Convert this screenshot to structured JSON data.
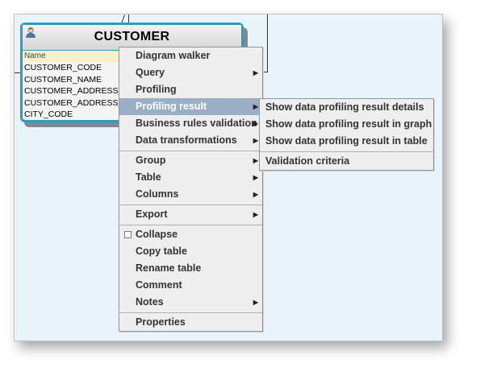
{
  "entity": {
    "title": "CUSTOMER",
    "column_header": "Name",
    "columns": [
      "CUSTOMER_CODE",
      "CUSTOMER_NAME",
      "CUSTOMER_ADDRESS_L",
      "CUSTOMER_ADDRESS_L",
      "CITY_CODE"
    ]
  },
  "context_menu": {
    "groups": [
      [
        "Diagram walker",
        "Query",
        "Profiling",
        "Profiling result",
        "Business rules validation",
        "Data transformations"
      ],
      [
        "Group",
        "Table",
        "Columns"
      ],
      [
        "Export"
      ],
      [
        "Collapse",
        "Copy table",
        "Rename table",
        "Comment",
        "Notes"
      ],
      [
        "Properties"
      ]
    ],
    "highlighted": "Profiling result"
  },
  "submenu": {
    "items": [
      "Show data profiling result details",
      "Show data profiling result in graph",
      "Show data profiling result in table"
    ],
    "extra": "Validation criteria"
  },
  "colors": {
    "accent": "#2a9fc4",
    "highlight": "#9aaec6",
    "canvas": "#e9f3fa"
  },
  "icons": {
    "entity": "user-icon",
    "submenu": "triangle-right"
  }
}
